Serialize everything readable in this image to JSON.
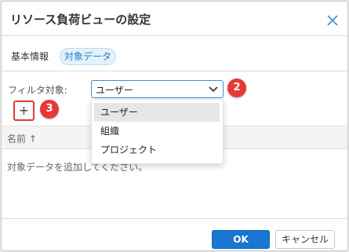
{
  "dialog": {
    "title": "リソース負荷ビューの設定"
  },
  "tabs": [
    {
      "label": "基本情報",
      "active": false
    },
    {
      "label": "対象データ",
      "active": true
    }
  ],
  "filter": {
    "label": "フィルタ対象:",
    "selected": "ユーザー",
    "options": [
      "ユーザー",
      "組織",
      "プロジェクト"
    ]
  },
  "annotations": {
    "badge_select": "2",
    "badge_add": "3"
  },
  "add_button": {
    "label": "+"
  },
  "table": {
    "column_name": "名前 ↑",
    "empty_message": "対象データを追加してください。"
  },
  "footer": {
    "ok_label": "OK",
    "cancel_label": "キャンセル"
  },
  "colors": {
    "accent": "#1976d2",
    "badge": "#e53935",
    "tab_active_bg": "#e3f1fb"
  },
  "icons": {
    "close": "close-icon",
    "dropdown": "chevron-down-icon"
  }
}
